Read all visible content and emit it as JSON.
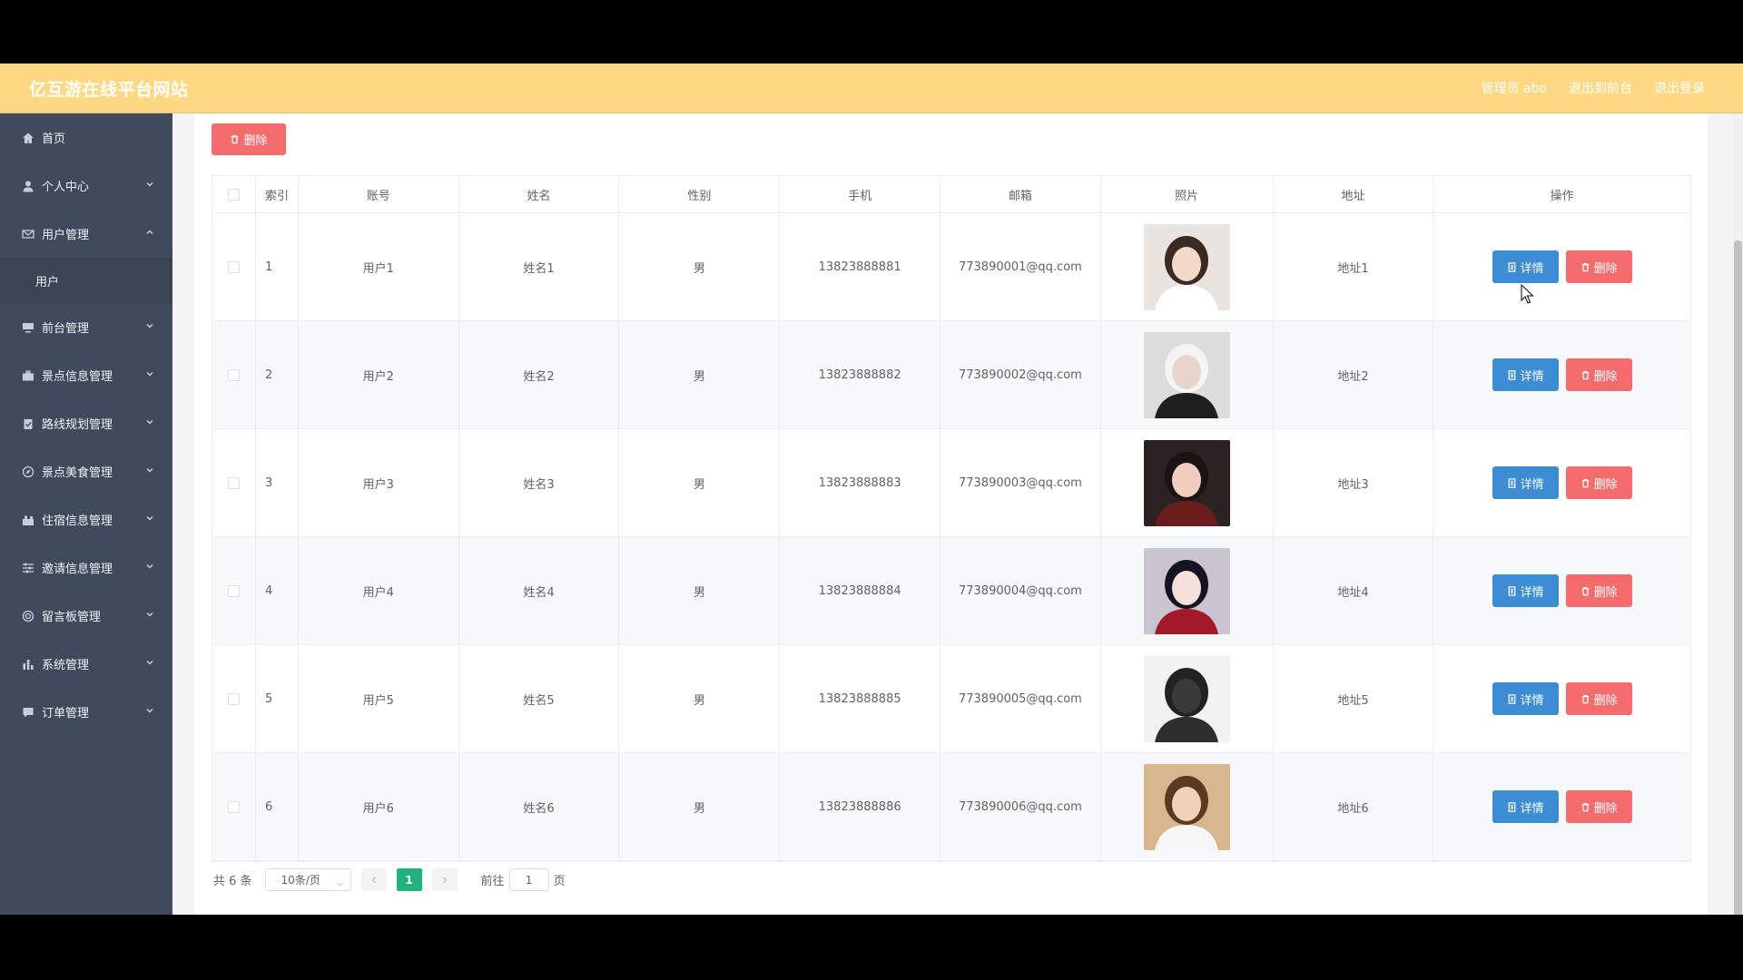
{
  "header": {
    "site_title": "亿互游在线平台网站",
    "admin_label": "管理员 abo",
    "to_front": "退出到前台",
    "logout": "退出登录"
  },
  "sidebar": {
    "items": [
      {
        "label": "首页",
        "icon": "home-icon"
      },
      {
        "label": "个人中心",
        "icon": "user-icon"
      },
      {
        "label": "用户管理",
        "icon": "mail-icon",
        "expanded": true
      },
      {
        "label": "用户",
        "sub": true
      },
      {
        "label": "前台管理",
        "icon": "monitor-icon"
      },
      {
        "label": "景点信息管理",
        "icon": "briefcase-icon"
      },
      {
        "label": "路线规划管理",
        "icon": "clipboard-icon"
      },
      {
        "label": "景点美食管理",
        "icon": "compass-icon"
      },
      {
        "label": "住宿信息管理",
        "icon": "house-icon"
      },
      {
        "label": "邀请信息管理",
        "icon": "sliders-icon"
      },
      {
        "label": "留言板管理",
        "icon": "circle-icon"
      },
      {
        "label": "系统管理",
        "icon": "bar-chart-icon"
      },
      {
        "label": "订单管理",
        "icon": "chat-icon"
      }
    ]
  },
  "toolbar": {
    "delete_label": "删除"
  },
  "table": {
    "headers": [
      "索引",
      "账号",
      "姓名",
      "性别",
      "手机",
      "邮箱",
      "照片",
      "地址",
      "操作"
    ],
    "rows": [
      {
        "idx": "1",
        "account": "用户1",
        "name": "姓名1",
        "sex": "男",
        "phone": "13823888881",
        "email": "773890001@qq.com",
        "address": "地址1"
      },
      {
        "idx": "2",
        "account": "用户2",
        "name": "姓名2",
        "sex": "男",
        "phone": "13823888882",
        "email": "773890002@qq.com",
        "address": "地址2"
      },
      {
        "idx": "3",
        "account": "用户3",
        "name": "姓名3",
        "sex": "男",
        "phone": "13823888883",
        "email": "773890003@qq.com",
        "address": "地址3"
      },
      {
        "idx": "4",
        "account": "用户4",
        "name": "姓名4",
        "sex": "男",
        "phone": "13823888884",
        "email": "773890004@qq.com",
        "address": "地址4"
      },
      {
        "idx": "5",
        "account": "用户5",
        "name": "姓名5",
        "sex": "男",
        "phone": "13823888885",
        "email": "773890005@qq.com",
        "address": "地址5"
      },
      {
        "idx": "6",
        "account": "用户6",
        "name": "姓名6",
        "sex": "男",
        "phone": "13823888886",
        "email": "773890006@qq.com",
        "address": "地址6"
      }
    ],
    "detail_label": "详情",
    "delete_label": "删除"
  },
  "pagination": {
    "total_text": "共 6 条",
    "page_size": "10条/页",
    "current_page": "1",
    "goto_prefix": "前往",
    "goto_value": "1",
    "goto_suffix": "页"
  },
  "colors": {
    "header_bg": "#ffd883",
    "sidebar_bg": "#404a5c",
    "danger": "#f56c6c",
    "primary": "#3c8dd4",
    "page_active": "#22b27b"
  }
}
